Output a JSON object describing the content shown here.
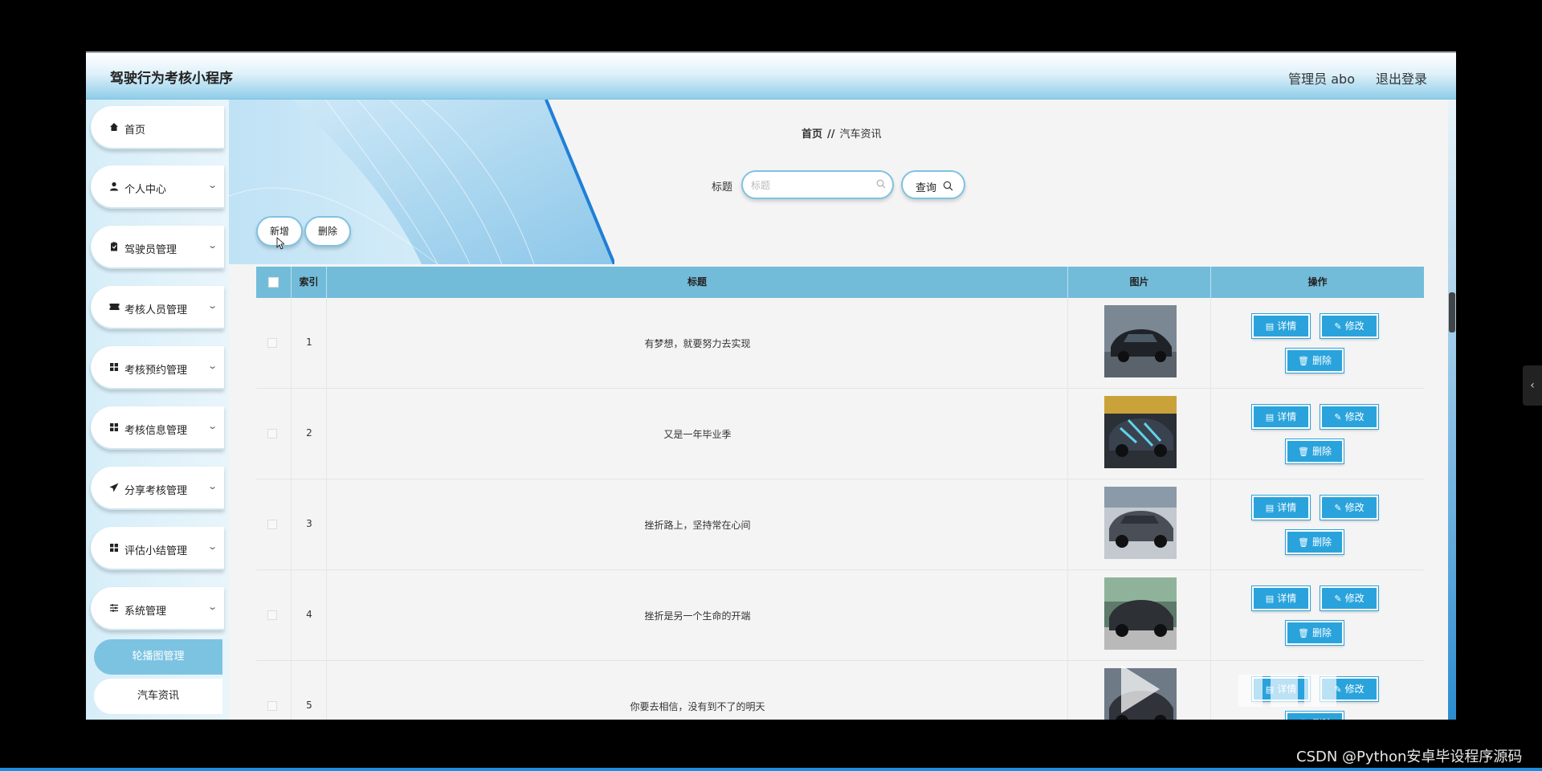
{
  "app": {
    "title": "驾驶行为考核小程序"
  },
  "header": {
    "admin_label": "管理员 abo",
    "logout_label": "退出登录"
  },
  "sidebar": {
    "items": [
      {
        "label": "首页",
        "icon": "home-icon"
      },
      {
        "label": "个人中心",
        "icon": "user-icon"
      },
      {
        "label": "驾驶员管理",
        "icon": "clipboard-icon"
      },
      {
        "label": "考核人员管理",
        "icon": "ticket-icon"
      },
      {
        "label": "考核预约管理",
        "icon": "grid-icon"
      },
      {
        "label": "考核信息管理",
        "icon": "grid-icon"
      },
      {
        "label": "分享考核管理",
        "icon": "send-icon"
      },
      {
        "label": "评估小结管理",
        "icon": "grid-icon"
      },
      {
        "label": "系统管理",
        "icon": "sliders-icon"
      }
    ],
    "sub_items": [
      {
        "label": "轮播图管理"
      },
      {
        "label": "汽车资讯"
      }
    ]
  },
  "breadcrumb": {
    "home": "首页",
    "separator": "//",
    "current": "汽车资讯"
  },
  "search": {
    "label": "标题",
    "placeholder": "标题",
    "query_label": "查询"
  },
  "toolbar": {
    "add_label": "新增",
    "delete_label": "删除"
  },
  "table": {
    "headers": {
      "index": "索引",
      "title": "标题",
      "image": "图片",
      "actions": "操作"
    },
    "action_labels": {
      "detail": "详情",
      "edit": "修改",
      "delete": "删除"
    },
    "rows": [
      {
        "index": "1",
        "title": "有梦想，就要努力去实现"
      },
      {
        "index": "2",
        "title": "又是一年毕业季"
      },
      {
        "index": "3",
        "title": "挫折路上，坚持常在心间"
      },
      {
        "index": "4",
        "title": "挫折是另一个生命的开端"
      },
      {
        "index": "5",
        "title": "你要去相信，没有到不了的明天"
      }
    ]
  },
  "watermark": "CSDN @Python安卓毕设程序源码",
  "colors": {
    "accent": "#2aa3dc",
    "header_blue": "#73bcd9",
    "sidebar_active": "#7cc3e2"
  }
}
